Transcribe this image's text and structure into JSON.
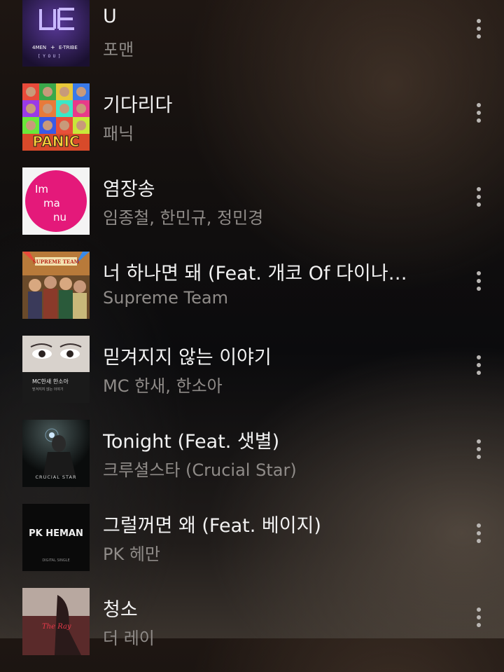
{
  "songs": [
    {
      "title": "U",
      "artist": "포맨",
      "art": "album-art-4men"
    },
    {
      "title": "기다리다",
      "artist": "패닉",
      "art": "album-art-panic"
    },
    {
      "title": "염장송",
      "artist": "임종철, 한민규, 정민경",
      "art": "album-art-immanu"
    },
    {
      "title": "너 하나면 돼 (Feat. 개코 Of 다이나…",
      "artist": "Supreme Team",
      "art": "album-art-supreme-team"
    },
    {
      "title": "믿겨지지 않는 이야기",
      "artist": "MC 한새, 한소아",
      "art": "album-art-mc-hansae"
    },
    {
      "title": "Tonight (Feat. 샛별)",
      "artist": "크루셜스타 (Crucial Star)",
      "art": "album-art-crucial-star"
    },
    {
      "title": "그럴꺼면 왜 (Feat. 베이지)",
      "artist": "PK 헤만",
      "art": "album-art-pk-heman"
    },
    {
      "title": "청소",
      "artist": "더 레이",
      "art": "album-art-the-ray"
    }
  ],
  "art_text": {
    "fourmen_brand": "4MEN",
    "fourmen_tribe": "E-TRIBE",
    "fourmen_you": "[   Y O U   ]",
    "panic_logo": "PANIC",
    "immanu_1": "Im",
    "immanu_2": "ma",
    "immanu_3": "nu",
    "supreme_banner": "SUPREME TEAM",
    "mc_line1": "MC한새 한소아",
    "mc_line2": "믿겨지지 않는 이야기",
    "crucial": "CRUCIAL STAR",
    "pk_logo": "PK HEMAN",
    "pk_sub": "DIGITAL SINGLE",
    "ray_logo": "The Ray"
  },
  "colors": {
    "title": "#f2f2f2",
    "artist": "#8f8b88",
    "menu_dots": "#b9b6b3"
  }
}
